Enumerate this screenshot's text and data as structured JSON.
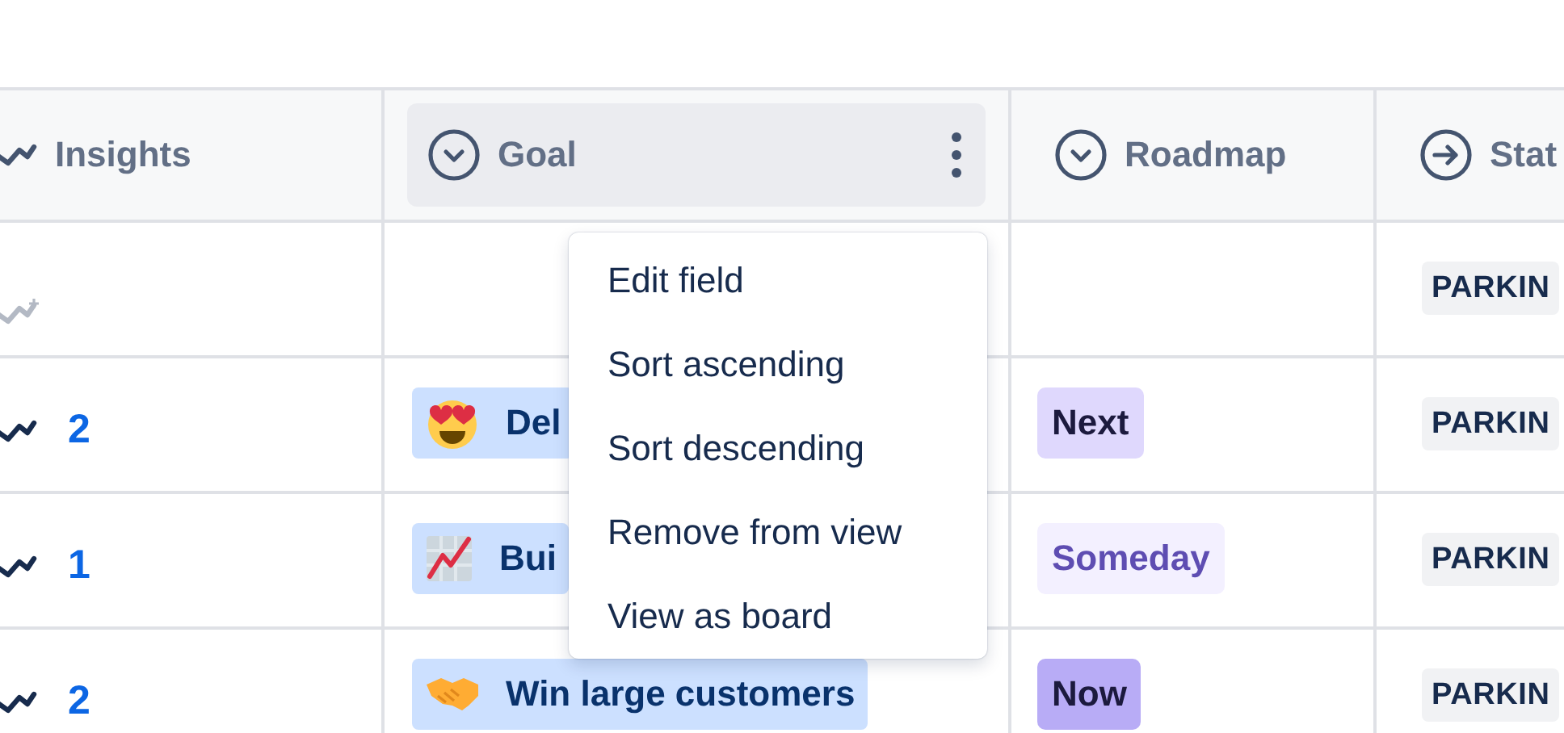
{
  "columns": [
    {
      "label": "Insights",
      "kind": "insights",
      "menu_open": false
    },
    {
      "label": "Goal",
      "kind": "select",
      "menu_open": true
    },
    {
      "label": "Roadmap",
      "kind": "select",
      "menu_open": false
    },
    {
      "label": "Stat",
      "kind": "status",
      "menu_open": false
    }
  ],
  "rows": [
    {
      "insights": {
        "kind": "empty"
      },
      "status": "PARKIN"
    },
    {
      "insights": {
        "kind": "count",
        "count": "2"
      },
      "goal": {
        "label": "Del"
      },
      "roadmap": {
        "label": "Next",
        "color": "#dfd8fd"
      },
      "status": "PARKIN"
    },
    {
      "insights": {
        "kind": "count",
        "count": "1"
      },
      "goal": {
        "label": "Bui"
      },
      "roadmap": {
        "label": "Someday",
        "color": "#f3f0ff"
      },
      "status": "PARKIN"
    },
    {
      "insights": {
        "kind": "count",
        "count": "2"
      },
      "goal": {
        "label": "Win large customers"
      },
      "roadmap": {
        "label": "Now",
        "color": "#b8acf6"
      },
      "status": "PARKIN"
    }
  ],
  "menu": {
    "items": [
      "Edit field",
      "Sort ascending",
      "Sort descending",
      "Remove from view",
      "View as board"
    ]
  }
}
